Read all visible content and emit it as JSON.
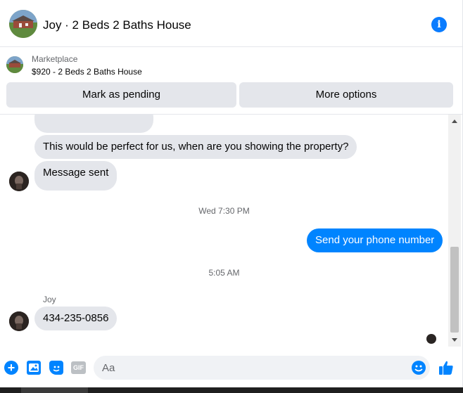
{
  "header": {
    "title": "Joy · 2 Beds 2 Baths House",
    "info_icon": "info-icon"
  },
  "marketplace": {
    "label": "Marketplace",
    "listing": "$920 - 2 Beds 2 Baths House",
    "buttons": {
      "pending": "Mark as pending",
      "more": "More options"
    }
  },
  "messages": [
    {
      "side": "in",
      "text": "This would be perfect for us, when are you showing the property?"
    },
    {
      "side": "in",
      "text": "Message sent"
    },
    {
      "side": "time",
      "text": "Wed 7:30 PM"
    },
    {
      "side": "out",
      "text": "Send your phone number"
    },
    {
      "side": "time",
      "text": "5:05 AM"
    },
    {
      "side": "in",
      "sender": "Joy",
      "text": "434-235-0856"
    }
  ],
  "composer": {
    "placeholder": "Aa",
    "gif_label": "GIF"
  },
  "colors": {
    "accent": "#0084ff",
    "bubble_in": "#e4e6eb",
    "info_blue": "#0a7cff"
  }
}
